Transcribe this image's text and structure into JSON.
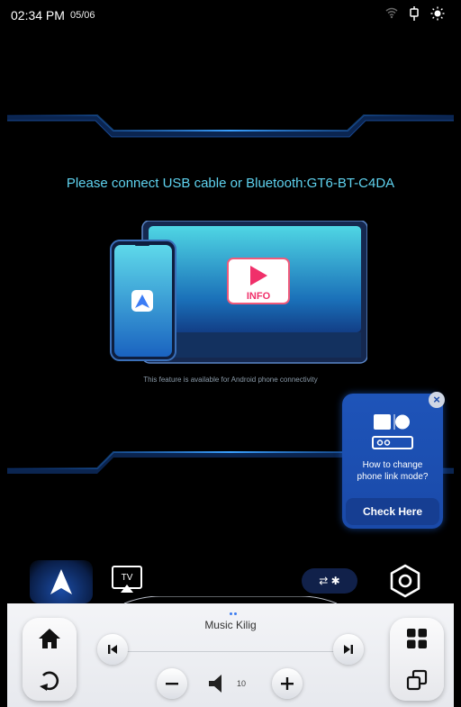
{
  "status": {
    "time": "02:34 PM",
    "date": "05/06",
    "icons": [
      "wifi-icon",
      "usb-phone-icon",
      "brightness-icon"
    ]
  },
  "main": {
    "prompt": "Please connect USB cable or Bluetooth:GT6-BT-C4DA",
    "note": "This feature is available for Android phone connectivity",
    "info_label": "INFO"
  },
  "popup": {
    "text_line1": "How to change",
    "text_line2": "phone link mode?",
    "button": "Check Here",
    "close": "×"
  },
  "dock": {
    "connection_label": "⇄ ✱",
    "tv_label": "TV"
  },
  "player": {
    "title": "Music  Kilig",
    "volume": "10"
  },
  "colors": {
    "accent": "#5fd3f0",
    "popup": "#1e54b9",
    "dock_active": "#1b4ca5"
  }
}
